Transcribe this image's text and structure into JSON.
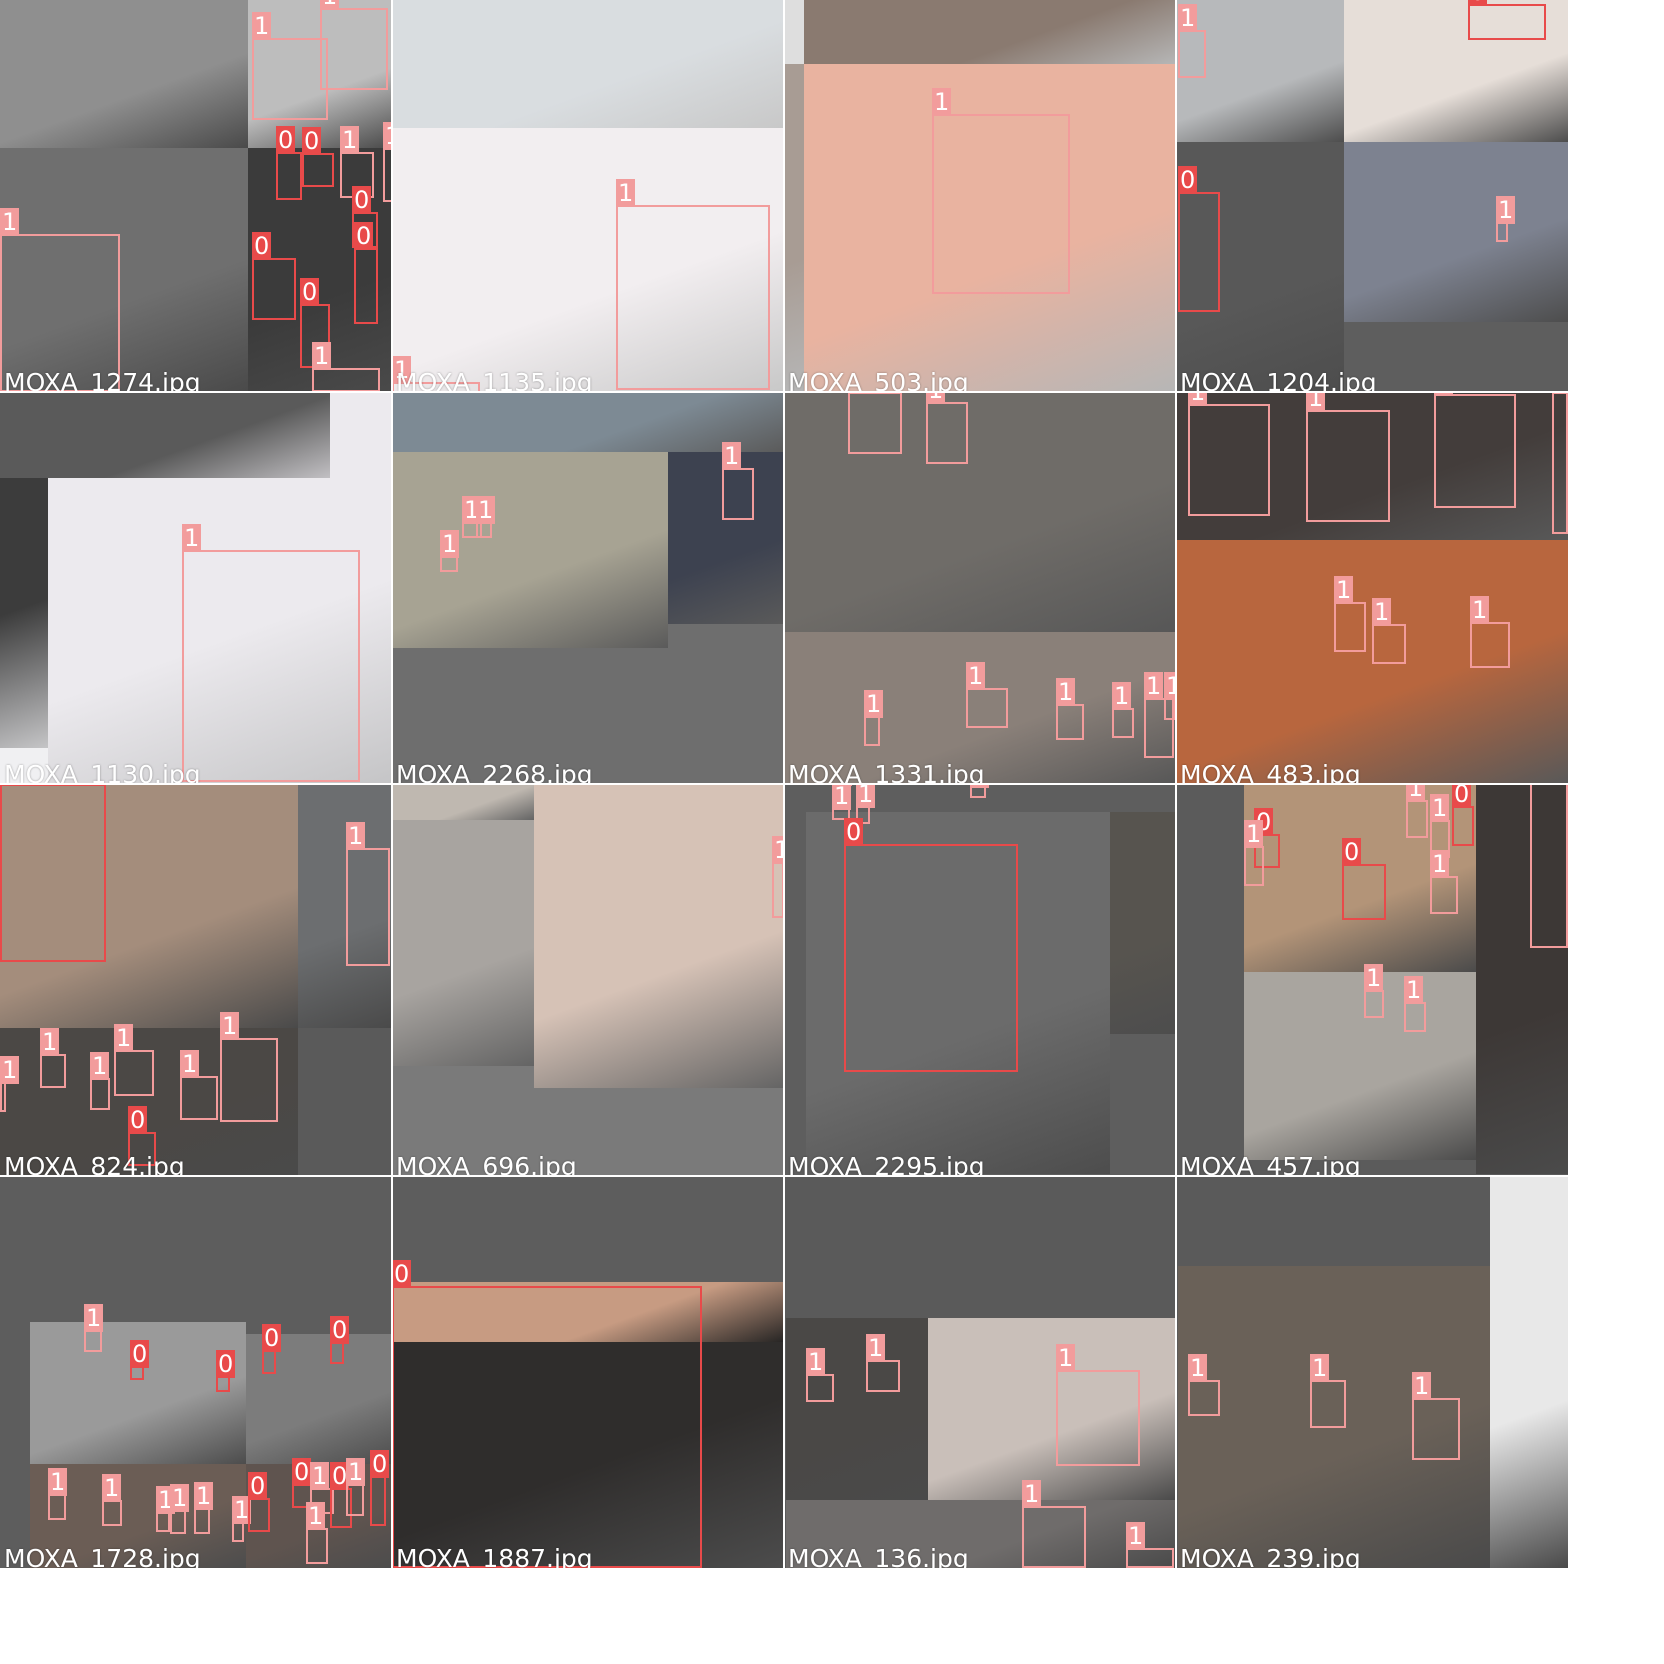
{
  "mosaic": {
    "class_colors": {
      "0": "#e84a4a",
      "1": "#f29c9c"
    },
    "tiles": [
      {
        "file": "MOXA_1274.jpg",
        "bg": "#5a5a5a",
        "photos": [
          {
            "c": "#8f8f8f"
          },
          {
            "c": "#bdbdbd"
          },
          {
            "c": "#6f6f6f"
          },
          {
            "c": "#3b3b3b"
          }
        ],
        "boxes": [
          {
            "cls": "1"
          },
          {
            "cls": "1"
          },
          {
            "cls": "0"
          },
          {
            "cls": "0"
          },
          {
            "cls": "1"
          },
          {
            "cls": "0"
          },
          {
            "cls": "1"
          },
          {
            "cls": "0"
          },
          {
            "cls": "0"
          },
          {
            "cls": "0"
          },
          {
            "cls": "1"
          },
          {
            "cls": "1"
          }
        ]
      },
      {
        "file": "MOXA_1135.jpg",
        "bg": "#f4f4f4",
        "photos": [
          {
            "c": "#d9dde0"
          },
          {
            "c": "#f2eef0"
          }
        ],
        "boxes": [
          {
            "cls": "1"
          },
          {
            "cls": "1"
          }
        ]
      },
      {
        "file": "MOXA_503.jpg",
        "bg": "#dedede",
        "photos": [
          {
            "c": "#8a7a70"
          },
          {
            "c": "#e9b3a0"
          },
          {
            "c": "#a89c94"
          }
        ],
        "boxes": [
          {
            "cls": "1"
          }
        ]
      },
      {
        "file": "MOXA_1204.jpg",
        "bg": "#5e5e5e",
        "photos": [
          {
            "c": "#b7b9bb"
          },
          {
            "c": "#e6ded8"
          },
          {
            "c": "#585858"
          },
          {
            "c": "#7d8290"
          }
        ],
        "boxes": [
          {
            "cls": "1"
          },
          {
            "cls": "0"
          },
          {
            "cls": "0"
          },
          {
            "cls": "1"
          }
        ]
      },
      {
        "file": "MOXA_1130.jpg",
        "bg": "#f0f0f2",
        "photos": [
          {
            "c": "#3c3c3c"
          },
          {
            "c": "#eceaee"
          },
          {
            "c": "#5a5a5a"
          }
        ],
        "boxes": [
          {
            "cls": "1"
          }
        ]
      },
      {
        "file": "MOXA_2268.jpg",
        "bg": "#6e6e6e",
        "photos": [
          {
            "c": "#7d8a94"
          },
          {
            "c": "#a7a393"
          },
          {
            "c": "#3d4250"
          }
        ],
        "boxes": [
          {
            "cls": "1"
          },
          {
            "cls": "1"
          },
          {
            "cls": "1"
          },
          {
            "cls": "1"
          }
        ]
      },
      {
        "file": "MOXA_1331.jpg",
        "bg": "#6a6a6a",
        "photos": [
          {
            "c": "#6f6c68"
          },
          {
            "c": "#8a8079"
          }
        ],
        "boxes": [
          {
            "cls": "1"
          },
          {
            "cls": "1"
          },
          {
            "cls": "1"
          },
          {
            "cls": "1"
          },
          {
            "cls": "1"
          },
          {
            "cls": "1"
          },
          {
            "cls": "1"
          },
          {
            "cls": "1"
          },
          {
            "cls": "1"
          }
        ]
      },
      {
        "file": "MOXA_483.jpg",
        "bg": "#6c6c6c",
        "photos": [
          {
            "c": "#433d3b"
          },
          {
            "c": "#b8663e"
          }
        ],
        "boxes": [
          {
            "cls": "1"
          },
          {
            "cls": "1"
          },
          {
            "cls": "1"
          },
          {
            "cls": "1"
          },
          {
            "cls": "1"
          },
          {
            "cls": "1"
          },
          {
            "cls": "1"
          }
        ]
      },
      {
        "file": "MOXA_824.jpg",
        "bg": "#5a5a5a",
        "photos": [
          {
            "c": "#a48d7c"
          },
          {
            "c": "#6c6e70"
          },
          {
            "c": "#4b4845"
          }
        ],
        "boxes": [
          {
            "cls": "0"
          },
          {
            "cls": "1"
          },
          {
            "cls": "1"
          },
          {
            "cls": "1"
          },
          {
            "cls": "1"
          },
          {
            "cls": "1"
          },
          {
            "cls": "1"
          },
          {
            "cls": "0"
          },
          {
            "cls": "1"
          },
          {
            "cls": "1"
          }
        ]
      },
      {
        "file": "MOXA_696.jpg",
        "bg": "#7a7a7a",
        "photos": [
          {
            "c": "#bfb8b0"
          },
          {
            "c": "#d6c2b6"
          },
          {
            "c": "#a8a4a0"
          }
        ],
        "boxes": [
          {
            "cls": "1"
          },
          {
            "cls": "1"
          }
        ]
      },
      {
        "file": "MOXA_2295.jpg",
        "bg": "#5e5e5e",
        "photos": [
          {
            "c": "#6b6b6b"
          },
          {
            "c": "#57544f"
          }
        ],
        "boxes": [
          {
            "cls": "1"
          },
          {
            "cls": "1"
          },
          {
            "cls": "1"
          },
          {
            "cls": "1"
          },
          {
            "cls": "0"
          }
        ]
      },
      {
        "file": "MOXA_457.jpg",
        "bg": "#5b5b5b",
        "photos": [
          {
            "c": "#b39478"
          },
          {
            "c": "#a9a59f"
          },
          {
            "c": "#3d3836"
          }
        ],
        "boxes": [
          {
            "cls": "1"
          },
          {
            "cls": "0"
          },
          {
            "cls": "1"
          },
          {
            "cls": "0"
          },
          {
            "cls": "1"
          },
          {
            "cls": "1"
          },
          {
            "cls": "0"
          },
          {
            "cls": "1"
          },
          {
            "cls": "1"
          },
          {
            "cls": "1"
          }
        ]
      },
      {
        "file": "MOXA_1728.jpg",
        "bg": "#5d5d5d",
        "photos": [
          {
            "c": "#9a9a9a"
          },
          {
            "c": "#7c7c7c"
          },
          {
            "c": "#6b5d55"
          },
          {
            "c": "#5f544f"
          }
        ],
        "boxes": [
          {
            "cls": "1"
          },
          {
            "cls": "0"
          },
          {
            "cls": "0"
          },
          {
            "cls": "0"
          },
          {
            "cls": "0"
          },
          {
            "cls": "1"
          },
          {
            "cls": "1"
          },
          {
            "cls": "1"
          },
          {
            "cls": "1"
          },
          {
            "cls": "1"
          },
          {
            "cls": "1"
          },
          {
            "cls": "0"
          },
          {
            "cls": "0"
          },
          {
            "cls": "1"
          },
          {
            "cls": "0"
          },
          {
            "cls": "1"
          },
          {
            "cls": "0"
          },
          {
            "cls": "1"
          }
        ]
      },
      {
        "file": "MOXA_1887.jpg",
        "bg": "#5d5d5d",
        "photos": [
          {
            "c": "#2f2d2c"
          },
          {
            "c": "#c79b82"
          }
        ],
        "boxes": [
          {
            "cls": "0"
          }
        ]
      },
      {
        "file": "MOXA_136.jpg",
        "bg": "#5a5a5a",
        "photos": [
          {
            "c": "#4a4846"
          },
          {
            "c": "#c9bfb9"
          },
          {
            "c": "#6f6c6b"
          }
        ],
        "boxes": [
          {
            "cls": "1"
          },
          {
            "cls": "1"
          },
          {
            "cls": "1"
          },
          {
            "cls": "1"
          },
          {
            "cls": "1"
          }
        ]
      },
      {
        "file": "MOXA_239.jpg",
        "bg": "#5a5a5a",
        "photos": [
          {
            "c": "#e8e8e8"
          },
          {
            "c": "#6a6158"
          }
        ],
        "boxes": [
          {
            "cls": "1"
          },
          {
            "cls": "1"
          },
          {
            "cls": "1"
          }
        ]
      }
    ]
  }
}
